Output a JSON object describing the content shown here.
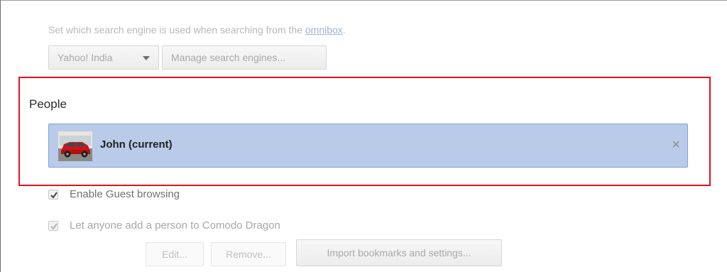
{
  "search": {
    "description_prefix": "Set which search engine is used when searching from the ",
    "description_link": "omnibox",
    "description_suffix": ".",
    "engine_selected": "Yahoo! India",
    "manage_label": "Manage search engines..."
  },
  "people": {
    "heading": "People",
    "users": [
      {
        "name": "John (current)"
      }
    ],
    "enable_guest_label": "Enable Guest browsing",
    "let_anyone_label": "Let anyone add a person to Comodo Dragon",
    "edit_label": "Edit...",
    "remove_label": "Remove...",
    "import_label": "Import bookmarks and settings..."
  },
  "icons": {
    "close": "×",
    "dropdown": "chevron-down-icon",
    "checkmark": "checkmark-icon",
    "avatar": "car-avatar-image"
  },
  "colors": {
    "highlight_border": "#e8101c",
    "selected_row_bg": "#b9cbe8",
    "selected_row_border": "#7fa3dc"
  }
}
